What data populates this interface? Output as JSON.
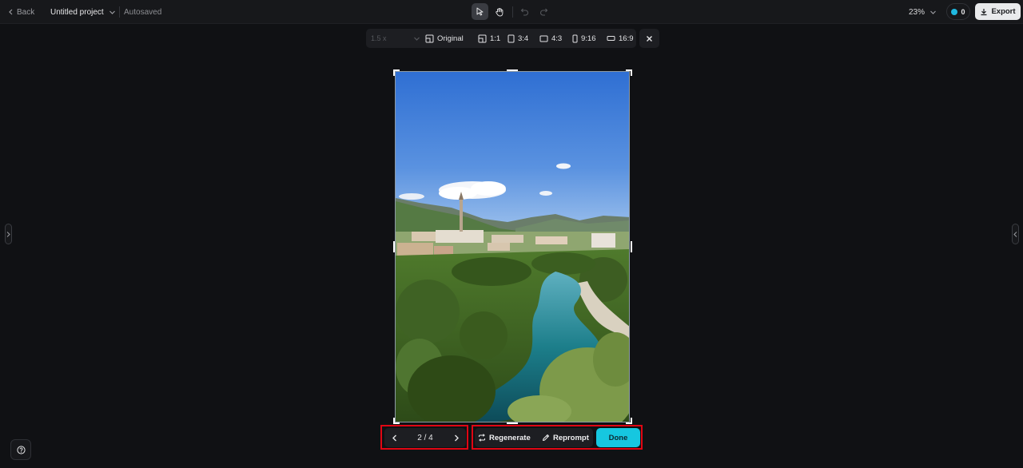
{
  "topbar": {
    "back_label": "Back",
    "project_title": "Untitled project",
    "status": "Autosaved",
    "tools": [
      {
        "icon": "pointer-icon",
        "active": true
      },
      {
        "icon": "hand-icon",
        "active": false
      },
      {
        "icon": "undo-icon",
        "active": false
      },
      {
        "icon": "redo-icon",
        "active": false
      }
    ],
    "zoom": "23%",
    "credits": "0",
    "export_label": "Export"
  },
  "ratio_bar": {
    "scale_value": "1.5 x",
    "options": [
      {
        "label": "Original",
        "icon": "original-ratio-icon"
      },
      {
        "label": "1:1",
        "icon": "square-ratio-icon"
      },
      {
        "label": "3:4",
        "icon": "portrait-ratio-icon"
      },
      {
        "label": "4:3",
        "icon": "landscape-ratio-icon"
      },
      {
        "label": "9:16",
        "icon": "tall-ratio-icon"
      },
      {
        "label": "16:9",
        "icon": "wide-ratio-icon"
      }
    ]
  },
  "image": {
    "description_icon": "landscape-photo"
  },
  "pager": {
    "current": "2 / 4"
  },
  "actions": {
    "regenerate_label": "Regenerate",
    "reprompt_label": "Reprompt",
    "done_label": "Done"
  },
  "colors": {
    "accent": "#16c7e0",
    "highlight": "#e00613",
    "background": "#101114"
  }
}
